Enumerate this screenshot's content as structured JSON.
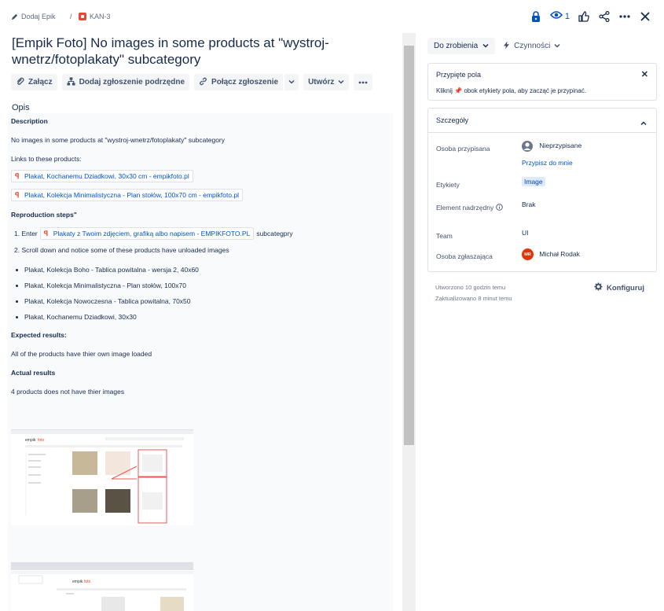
{
  "breadcrumb": {
    "add_epic": "Dodaj Epik",
    "separator": "/",
    "issue_key": "KAN-3"
  },
  "header": {
    "watchers_count": "1"
  },
  "issue": {
    "title": "[Empik Foto] No images in some products at \"wystroj-wnetrz/fotoplakaty\" subcategory"
  },
  "toolbar": {
    "attach": "Załącz",
    "add_child": "Dodaj zgłoszenie podrzędne",
    "link_issue": "Połącz zgłoszenie",
    "create": "Utwórz"
  },
  "description": {
    "section_label": "Opis",
    "heading": "Description",
    "intro": "No images in some products at \"wystroj-wnetrz/fotoplakaty\" subcategory",
    "links_label": "Links to these products:",
    "link1": "Plakat, Kochanemu Dziadkowi, 30x30 cm - empikfoto.pl",
    "link2": "Plakat, Kolekcja Minimalistyczna - Plan stołów, 100x70 cm - empikfoto.pl",
    "repro_heading": "Reproduction steps\"",
    "step1_prefix": "1. Enter",
    "step1_link": "Plakaty z Twoim zdjęciem, grafiką albo napisem - EMPIKFOTO.PL",
    "step1_suffix": "subcategpry",
    "step2": "2. Scroll down and notice some of these products have unloaded images",
    "bullets": [
      "Plakat, Kolekcja Boho - Tablica powitalna - wersja 2, 40x60",
      "Plakat, Kolekcja Minimalistyczna - Plan stołów, 100x70",
      "Plakat, Kolekcja Nowoczesna - Tablica powitalna, 70x50",
      "Plakat, Kochanemu Dziadkowi, 30x30"
    ],
    "expected_heading": "Expected results:",
    "expected_text": "All of the products have thier own image loaded",
    "actual_heading": "Actual results",
    "actual_text": "4 products does not have thier images"
  },
  "sidebar": {
    "status": "Do zrobienia",
    "actions": "Czynności",
    "pinned_title": "Przypięte pola",
    "pinned_text_pre": "Kliknij",
    "pinned_text_post": "obok etykiety pola, aby zacząć je przypinać.",
    "details_title": "Szczegóły",
    "fields": {
      "assignee_label": "Osoba przypisana",
      "assignee_value": "Nieprzypisane",
      "assign_to_me": "Przypisz do mnie",
      "labels_label": "Etykiety",
      "labels_value": "Image",
      "parent_label": "Element nadrzędny",
      "parent_value": "Brak",
      "team_label": "Team",
      "team_value": "UI",
      "reporter_label": "Osoba zgłaszająca",
      "reporter_initials": "MR",
      "reporter_name": "Michał Rodak"
    },
    "created": "Utworzono 10 godzin temu",
    "updated": "Zaktualizowano 8 minut temu",
    "configure": "Konfiguruj"
  },
  "colors": {
    "accent": "#0052cc",
    "status_bg": "#f4f5f7",
    "reporter_avatar": "#de350b"
  }
}
